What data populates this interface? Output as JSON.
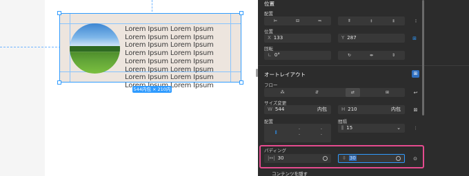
{
  "canvas": {
    "body_text": "Lorem Ipsum Lorem Ipsum Lorem Ipsum Lorem Ipsum Lorem Ipsum Lorem Ipsum Lorem Ipsum Lorem Ipsum Lorem Ipsum Lorem Ipsum Lorem Ipsum Lorem Ipsum Lorem Ipsum Lorem Ipsum Lorem Ipsum Lorem Ipsum",
    "size_badge": "544内包 × 210内包"
  },
  "panel": {
    "position": {
      "header": "位置",
      "align_label": "配置",
      "coords_label": "位置",
      "x_prefix": "X",
      "x_value": "133",
      "y_prefix": "Y",
      "y_value": "287",
      "rotation_label": "回転",
      "rotation_value": "0°"
    },
    "autolayout": {
      "header": "オートレイアウト",
      "flow_label": "フロー",
      "resize_label": "サイズ変更",
      "w_prefix": "W",
      "w_value": "544",
      "w_mode": "内包",
      "h_prefix": "H",
      "h_value": "210",
      "h_mode": "内包",
      "align_label": "配置",
      "gap_label": "間隔",
      "gap_value": "15",
      "padding_label": "パディング",
      "padding_h_value": "30",
      "padding_v_value": "30",
      "clip_label": "コンテンツを隠す"
    }
  },
  "colors": {
    "selection": "#2f9bff",
    "highlight": "#e64b8f",
    "frame_fill": "#ede5de"
  }
}
